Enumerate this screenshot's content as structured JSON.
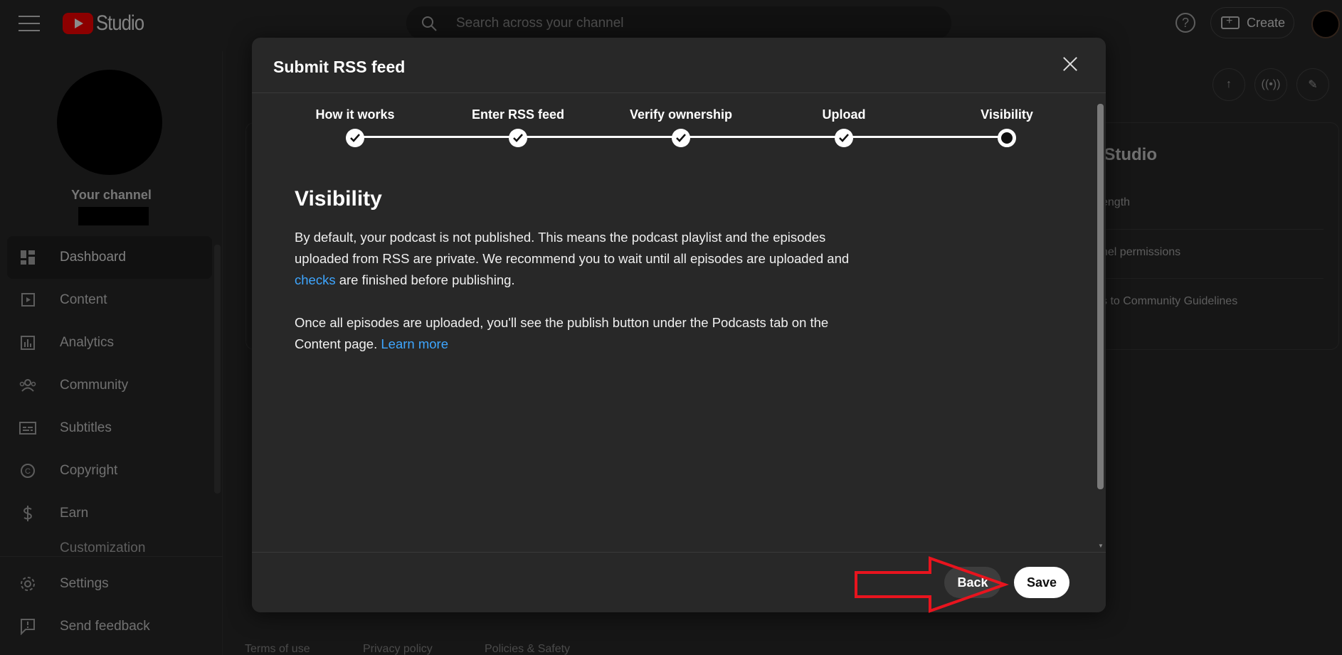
{
  "topbar": {
    "logo_text": "Studio",
    "search_placeholder": "Search across your channel",
    "help_symbol": "?",
    "create_label": "Create"
  },
  "sidebar": {
    "channel_label": "Your channel",
    "items": [
      {
        "label": "Dashboard",
        "icon": "dashboard-icon"
      },
      {
        "label": "Content",
        "icon": "content-icon"
      },
      {
        "label": "Analytics",
        "icon": "analytics-icon"
      },
      {
        "label": "Community",
        "icon": "community-icon"
      },
      {
        "label": "Subtitles",
        "icon": "subtitles-icon"
      },
      {
        "label": "Copyright",
        "icon": "copyright-icon"
      },
      {
        "label": "Earn",
        "icon": "earn-icon"
      }
    ],
    "partial_item": "Customization",
    "bottom_items": [
      {
        "label": "Settings",
        "icon": "gear-icon"
      },
      {
        "label": "Send feedback",
        "icon": "feedback-icon"
      }
    ]
  },
  "background": {
    "card_title": "n Studio",
    "lines": [
      "ength",
      "nel permissions",
      "s to Community Guidelines"
    ],
    "footer_links": [
      "Terms of use",
      "Privacy policy",
      "Policies & Safety"
    ]
  },
  "dialog": {
    "title": "Submit RSS feed",
    "steps": [
      {
        "label": "How it works",
        "state": "done"
      },
      {
        "label": "Enter RSS feed",
        "state": "done"
      },
      {
        "label": "Verify ownership",
        "state": "done"
      },
      {
        "label": "Upload",
        "state": "done"
      },
      {
        "label": "Visibility",
        "state": "current"
      }
    ],
    "heading": "Visibility",
    "para1_before": "By default, your podcast is not published. This means the podcast playlist and the episodes uploaded from RSS are private. We recommend you to wait until all episodes are uploaded and ",
    "para1_link": "checks",
    "para1_after": " are finished before publishing.",
    "para2_before": "Once all episodes are uploaded, you'll see the publish button under the Podcasts tab on the Content page. ",
    "para2_link": "Learn more",
    "back_label": "Back",
    "save_label": "Save"
  },
  "colors": {
    "accent_link": "#3ea6ff",
    "annotation_arrow": "#e8141e",
    "brand_red": "#ff0000"
  }
}
